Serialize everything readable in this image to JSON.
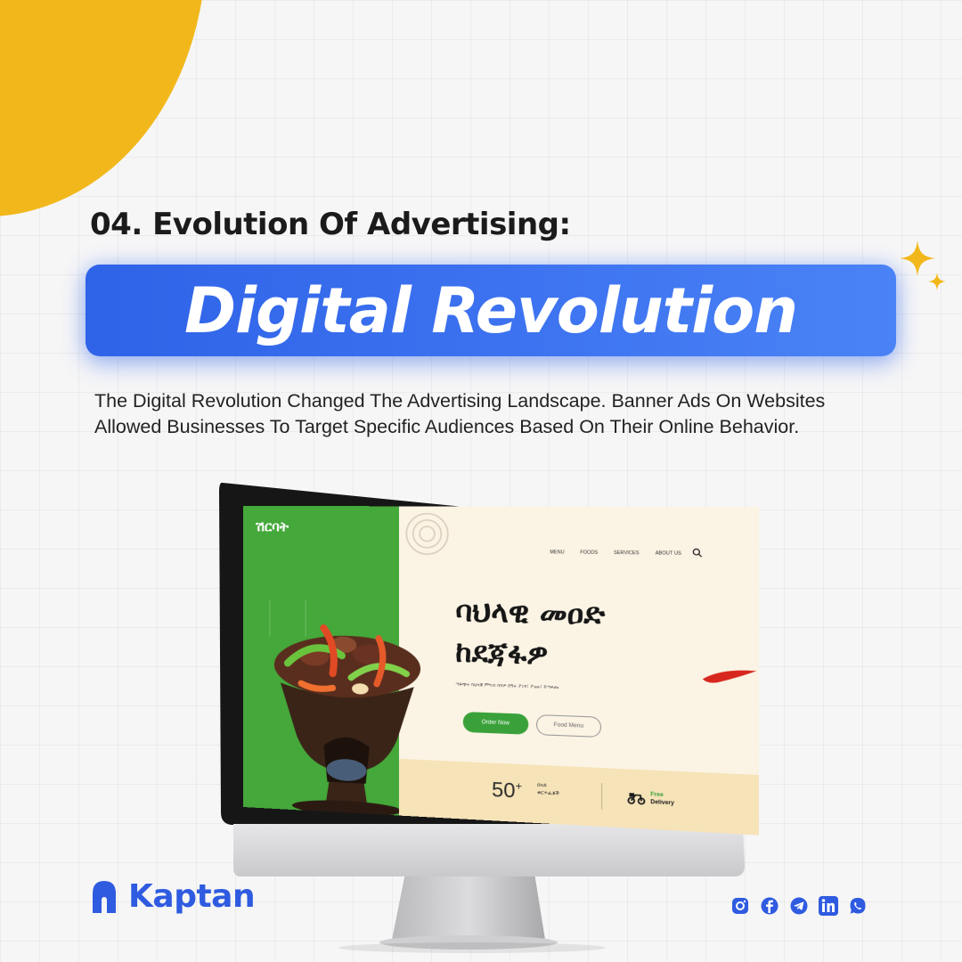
{
  "heading": "04. Evolution Of Advertising:",
  "banner": "Digital Revolution",
  "description": "The Digital Revolution Changed The Advertising Landscape. Banner Ads On Websites Allowed Businesses To Target Specific Audiences Based On Their Online Behavior.",
  "site": {
    "logo": "ሽርባት",
    "nav": [
      "MENU",
      "FOODS",
      "SERVICES",
      "ABOUT US"
    ],
    "hero_title": "ባህላዊ መዐድ\nከደጃፋዎ",
    "hero_subtitle": "ጣፋጭና ባህላዊ ምግብ ባሻዎ ሰዓት ያገኙ፣ ያዝዙ፣ ይጣፍጡ",
    "order_button": "Order Now",
    "menu_button": "Food Menu",
    "stat_number": "50",
    "stat_plus": "+",
    "stat_label": "በላይ\nቀርጥፊቶች",
    "delivery_free": "Free",
    "delivery_label": "Delivery"
  },
  "brand": {
    "name": "Kaptan"
  },
  "socials": [
    "instagram-icon",
    "facebook-icon",
    "telegram-icon",
    "linkedin-icon",
    "whatsapp-icon"
  ],
  "colors": {
    "accent_yellow": "#f2b81b",
    "banner_blue": "#3d73f0",
    "brand_blue": "#2f5be0",
    "site_green": "#45a83a"
  }
}
